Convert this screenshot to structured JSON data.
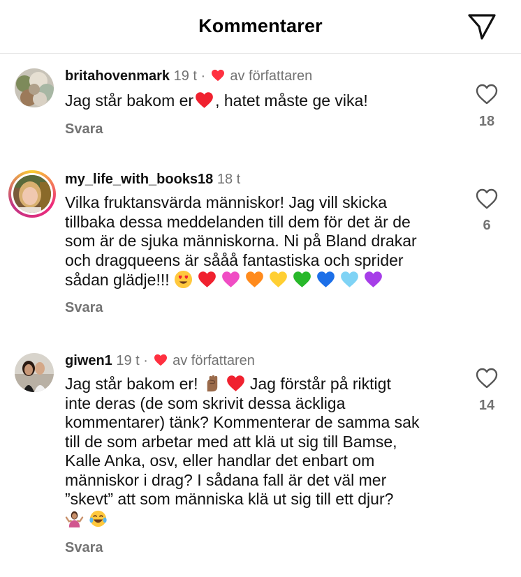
{
  "header": {
    "title": "Kommentarer",
    "share_icon": "paper-plane-icon"
  },
  "comments": [
    {
      "username": "britahovenmark",
      "time": "19 t",
      "separator": "·",
      "author_liked": true,
      "author_label": "av författaren",
      "text_a": "Jag står bakom er",
      "text_b": ", hatet måste ge vika!",
      "reply": "Svara",
      "likes": "18"
    },
    {
      "username": "my_life_with_books18",
      "time": "18 t",
      "author_liked": false,
      "text": "Vilka fruktansvärda människor! Jag vill skicka\ntillbaka dessa meddelanden till dem för det är de\nsom är de sjuka människorna. Ni på Bland drakar\noch dragqueens är sååå fantastiska och sprider\nsådan glädje!!!",
      "emoji_row": [
        "heart-eyes-emoji",
        "red-heart-emoji",
        "pink-heart-emoji",
        "orange-heart-emoji",
        "yellow-heart-emoji",
        "green-heart-emoji",
        "blue-heart-emoji",
        "light-blue-heart-emoji",
        "purple-heart-emoji"
      ],
      "reply": "Svara",
      "likes": "6"
    },
    {
      "username": "giwen1",
      "time": "19 t",
      "separator": "·",
      "author_liked": true,
      "author_label": "av författaren",
      "text_a": "Jag står bakom er!",
      "text_b": "Jag förstår på riktigt",
      "text_c": "inte deras (de som skrivit dessa äckliga\nkommentarer) tänk? Kommenterar de samma sak\ntill de som arbetar med att klä ut sig till Bamse,\nKalle Anka, osv, eller handlar det enbart om\nmänniskor i drag? I sådana fall är det väl mer\n”skevt” att som människa klä ut sig till ett djur?",
      "reply": "Svara",
      "likes": "14"
    }
  ],
  "colors": {
    "author_heart": "#ff3040",
    "secondary_text": "#737373",
    "divider": "#e6e6e6"
  }
}
